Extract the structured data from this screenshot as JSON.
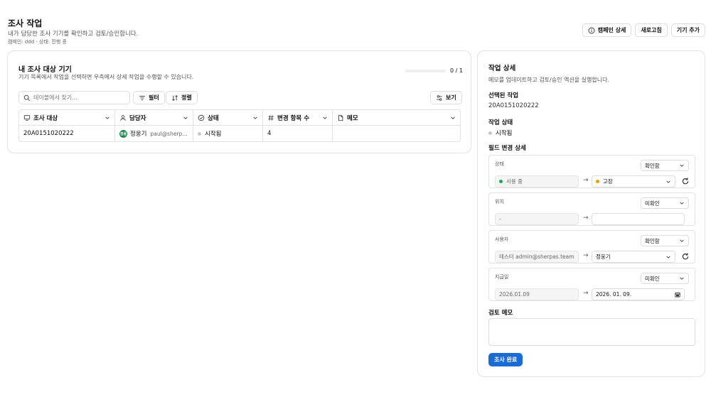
{
  "header": {
    "title": "조사 작업",
    "subtitle": "내가 담당한 조사 기기를 확인하고 검토/승인합니다.",
    "campaign_info": "캠페인: ddd · 상태: 진행 중",
    "buttons": {
      "campaign_detail": "캠페인 상세",
      "refresh": "새로고침",
      "add_device": "기기 추가"
    }
  },
  "list_panel": {
    "title": "내 조사 대상 기기",
    "subtitle": "기기 목록에서 작업을 선택하면 우측에서 상세 작업을 수행할 수 있습니다.",
    "progress_text": "0 / 1",
    "progress_fraction": 0,
    "search_placeholder": "테이블에서 찾기...",
    "filter_label": "필터",
    "sort_label": "정렬",
    "view_label": "보기",
    "columns": [
      "조사 대상",
      "담당자",
      "상태",
      "변경 항목 수",
      "메모"
    ],
    "rows": [
      {
        "target": "20A0151020222",
        "assignee_initials": "정웅",
        "assignee_name": "정웅기",
        "assignee_email": "paul@sherpas.team",
        "status": "시작됨",
        "change_count": "4",
        "memo": ""
      }
    ]
  },
  "detail_panel": {
    "title": "작업 상세",
    "subtitle": "메모를 업데이트하고 검토/승인 액션을 실행합니다.",
    "selected_label": "선택된 작업",
    "selected_value": "20A0151020222",
    "status_label": "작업 상태",
    "status_value": "시작됨",
    "field_changes_label": "필드 변경 상세",
    "fields": [
      {
        "label": "상태",
        "review": "확인함",
        "old": "사용 중",
        "new": "고장",
        "old_dot": "#22a55a",
        "new_dot": "#e6a100"
      },
      {
        "label": "위치",
        "review": "미확인",
        "old": "-",
        "new": ""
      },
      {
        "label": "사용자",
        "review": "확인함",
        "old": "테스터 admin@sherpas.team",
        "new": "정웅기"
      },
      {
        "label": "지급일",
        "review": "미확인",
        "old": "2026.01.09",
        "new": "2026. 01. 09."
      }
    ],
    "memo_label": "검토 메모",
    "memo_value": "",
    "complete_label": "조사 완료"
  },
  "colors": {
    "accent": "#1a6bd4",
    "status_started": "#c8c8c8"
  }
}
